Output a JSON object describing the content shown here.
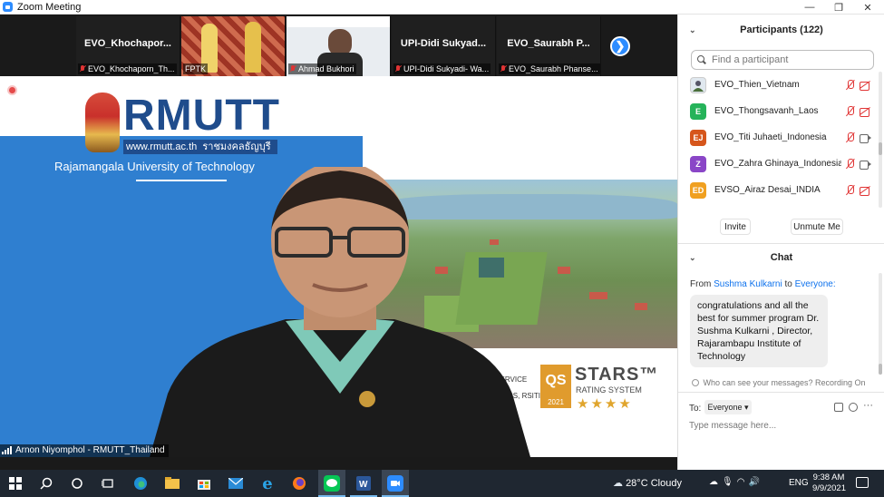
{
  "window": {
    "title": "Zoom Meeting",
    "min_glyph": "—",
    "max_glyph": "❐",
    "close_glyph": "✕"
  },
  "strip": {
    "thumbs": [
      {
        "name": "EVO_Khochapor...",
        "label": "EVO_Khochaporn_Th..."
      },
      {
        "name": "",
        "label": "FPTK"
      },
      {
        "name": "",
        "label": "Ahmad Bukhori"
      },
      {
        "name": "UPI-Didi  Sukyad...",
        "label": "UPI-Didi Sukyadi- Wa..."
      },
      {
        "name": "EVO_Saurabh  P...",
        "label": "EVO_Saurabh Phanse..."
      }
    ],
    "next_glyph": "❯"
  },
  "main_video": {
    "logo": "RMUTT",
    "logo_url": "www.rmutt.ac.th",
    "logo_url_thai": "ราชมงคลธัญบุรี",
    "university": "Rajamangala University of Technology",
    "qs_logo": "QS",
    "qs_title": "STARS™",
    "qs_subtitle": "RATING SYSTEM",
    "qs_year": "2021",
    "qs_stars": "★★★★",
    "service_text_1": "ON SERVICE",
    "service_text_2": "SCHOOLS, RSITIES",
    "speaker_label": "Arnon Niyomphol - RMUTT_Thailand"
  },
  "participants": {
    "header": "Participants (122)",
    "search_placeholder": "Find a participant",
    "rows": [
      {
        "initials": "",
        "name": "EVO_Thien_Vietnam",
        "color": "#ffffff",
        "cam": "off"
      },
      {
        "initials": "E",
        "name": "EVO_Thongsavanh_Laos",
        "color": "#25b35a",
        "cam": "off"
      },
      {
        "initials": "EJ",
        "name": "EVO_Titi Juhaeti_Indonesia",
        "color": "#d6561c",
        "cam": "on"
      },
      {
        "initials": "Z",
        "name": "EVO_Zahra Ghinaya_Indonesia",
        "color": "#8a46c7",
        "cam": "on"
      },
      {
        "initials": "ED",
        "name": "EVSO_Airaz Desai_INDIA",
        "color": "#f0a020",
        "cam": "off"
      }
    ],
    "invite": "Invite",
    "unmute_me": "Unmute Me"
  },
  "chat": {
    "header": "Chat",
    "from_prefix": "From",
    "from_user": "Sushma Kulkarni",
    "from_to": "to",
    "from_target": "Everyone:",
    "message": "congratulations and all the best for summer program Dr. Sushma Kulkarni , Director, Rajarambapu Institute of Technology",
    "who_sees": "Who can see your messages? Recording On",
    "to_label": "To:",
    "recipient": "Everyone ▾",
    "placeholder": "Type message here...",
    "more_glyph": "···"
  },
  "taskbar": {
    "weather": "28°C  Cloudy",
    "lang": "ENG",
    "time": "9:38 AM",
    "date": "9/9/2021"
  }
}
